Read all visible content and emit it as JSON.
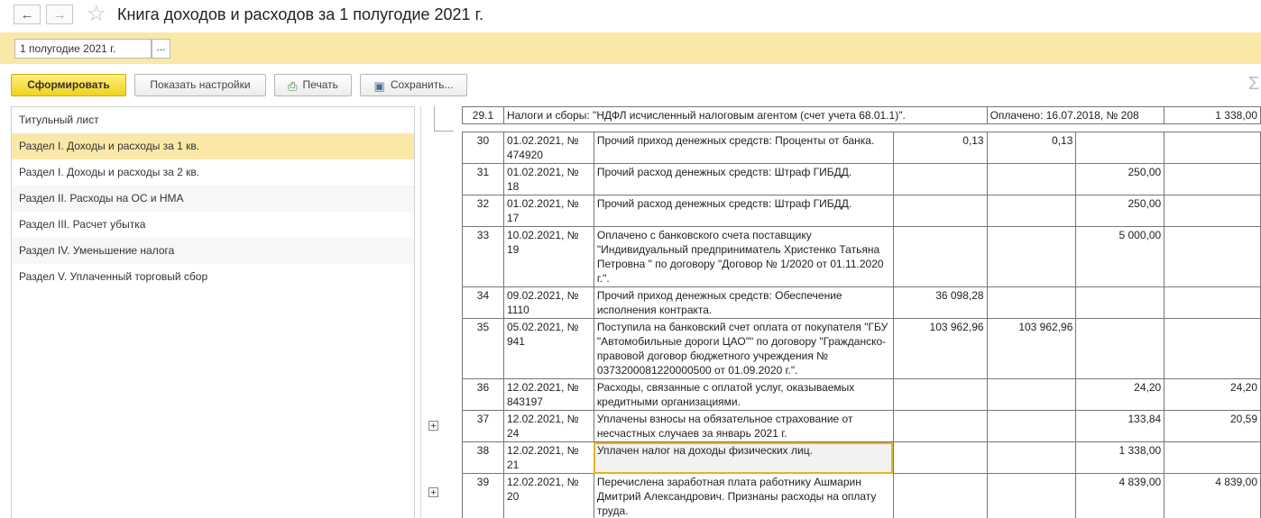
{
  "window": {
    "title": "Книга доходов и расходов за 1 полугодие 2021 г."
  },
  "nav": {
    "back_icon": "arrow-left-icon",
    "forward_icon": "arrow-right-icon",
    "favorite_icon": "star-icon"
  },
  "period": {
    "value": "1 полугодие 2021 г.",
    "picker_label": "..."
  },
  "toolbar": {
    "generate_label": "Сформировать",
    "settings_label": "Показать настройки",
    "print_label": "Печать",
    "save_label": "Сохранить...",
    "sum_icon": "Σ"
  },
  "sections": [
    {
      "label": "Титульный лист"
    },
    {
      "label": "Раздел I. Доходы и расходы за 1 кв."
    },
    {
      "label": "Раздел I. Доходы и расходы за 2 кв."
    },
    {
      "label": "Раздел II. Расходы на ОС и НМА"
    },
    {
      "label": "Раздел III. Расчет убытка"
    },
    {
      "label": "Раздел IV. Уменьшение налога"
    },
    {
      "label": "Раздел V. Уплаченный торговый сбор"
    }
  ],
  "report": {
    "header_row": {
      "num": "29.1",
      "text": "Налоги и сборы: \"НДФЛ исчисленный налоговым агентом (счет учета 68.01.1)\".",
      "payment": "Оплачено: 16.07.2018, № 208",
      "amount": "1 338,00"
    },
    "rows": [
      {
        "num": "30",
        "doc": "01.02.2021, № 474920",
        "content": "Прочий приход денежных средств: Проценты от банка.",
        "income_all": "0,13",
        "income_tax": "0,13",
        "expense_all": "",
        "expense_tax": ""
      },
      {
        "num": "31",
        "doc": "01.02.2021, № 18",
        "content": "Прочий расход денежных средств: Штраф ГИБДД.",
        "income_all": "",
        "income_tax": "",
        "expense_all": "250,00",
        "expense_tax": ""
      },
      {
        "num": "32",
        "doc": "01.02.2021, № 17",
        "content": "Прочий расход денежных средств: Штраф ГИБДД.",
        "income_all": "",
        "income_tax": "",
        "expense_all": "250,00",
        "expense_tax": ""
      },
      {
        "num": "33",
        "doc": "10.02.2021, № 19",
        "content": "Оплачено с банковского счета поставщику \"Индивидуальный предприниматель Христенко Татьяна Петровна \" по договору \"Договор № 1/2020 от 01.11.2020 г.\".",
        "income_all": "",
        "income_tax": "",
        "expense_all": "5 000,00",
        "expense_tax": ""
      },
      {
        "num": "34",
        "doc": "09.02.2021, № 1110",
        "content": "Прочий приход денежных средств: Обеспечение исполнения контракта.",
        "income_all": "36 098,28",
        "income_tax": "",
        "expense_all": "",
        "expense_tax": ""
      },
      {
        "num": "35",
        "doc": "05.02.2021, № 941",
        "content": "Поступила на банковский счет оплата от покупателя \"ГБУ \"Автомобильные дороги ЦАО\"\" по договору \"Гражданско-правовой договор бюджетного учреждения № 0373200081220000500 от 01.09.2020 г.\".",
        "income_all": "103 962,96",
        "income_tax": "103 962,96",
        "expense_all": "",
        "expense_tax": ""
      },
      {
        "num": "36",
        "doc": "12.02.2021, № 843197",
        "content": "Расходы, связанные с оплатой услуг, оказываемых кредитными организациями.",
        "income_all": "",
        "income_tax": "",
        "expense_all": "24,20",
        "expense_tax": "24,20"
      },
      {
        "num": "37",
        "doc": "12.02.2021, № 24",
        "content": "Уплачены взносы на обязательное страхование от несчастных случаев за январь 2021 г.",
        "income_all": "",
        "income_tax": "",
        "expense_all": "133,84",
        "expense_tax": "20,59"
      },
      {
        "num": "38",
        "doc": "12.02.2021, № 21",
        "content": "Уплачен налог на доходы физических лиц.",
        "income_all": "",
        "income_tax": "",
        "expense_all": "1 338,00",
        "expense_tax": ""
      },
      {
        "num": "39",
        "doc": "12.02.2021, № 20",
        "content": "Перечислена заработная плата работнику Ашмарин Дмитрий Александрович. Признаны расходы на оплату труда.",
        "income_all": "",
        "income_tax": "",
        "expense_all": "4 839,00",
        "expense_tax": "4 839,00"
      }
    ]
  }
}
